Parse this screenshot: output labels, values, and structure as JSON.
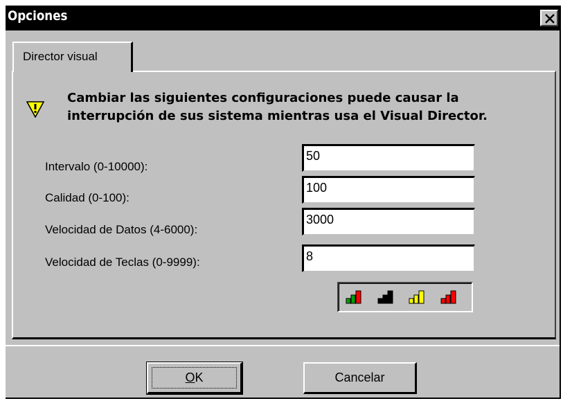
{
  "window": {
    "title": "Opciones",
    "close_glyph": "✕"
  },
  "tabs": [
    {
      "label": "Director visual",
      "selected": true
    }
  ],
  "warning": {
    "icon": "warning-triangle-icon",
    "text": "Cambiar las siguientes configuraciones puede causar la interrupción de sus sistema mientras usa el Visual Director."
  },
  "fields": [
    {
      "label": "Intervalo (0-10000):",
      "value": "50"
    },
    {
      "label": "Calidad (0-100):",
      "value": "100"
    },
    {
      "label": "Velocidad de Datos (4-6000):",
      "value": "3000"
    },
    {
      "label": "Velocidad de Teclas (0-9999):",
      "value": "8"
    }
  ],
  "speed_presets": [
    {
      "name": "green-speed-icon",
      "color": "#00a000"
    },
    {
      "name": "black-speed-icon",
      "color": "#000000"
    },
    {
      "name": "yellow-speed-icon",
      "color": "#ffff00"
    },
    {
      "name": "red-speed-icon",
      "color": "#ff0000"
    }
  ],
  "buttons": {
    "ok_mnemonic": "O",
    "ok_rest": "K",
    "cancel": "Cancelar"
  }
}
